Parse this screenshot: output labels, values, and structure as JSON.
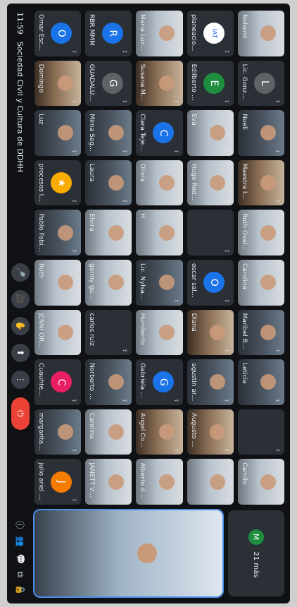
{
  "meeting": {
    "time": "11:59",
    "title": "Sociedad Civil y Cultura de DDHH"
  },
  "tiles": [
    {
      "name": "Nohemi",
      "type": "video",
      "tone": "light"
    },
    {
      "name": "Lic. Gonzalez",
      "type": "avatar",
      "initial": "L",
      "color": "#5f6368"
    },
    {
      "name": "Noeli",
      "type": "video",
      "tone": "dark"
    },
    {
      "name": "Maestra Isabel",
      "type": "video",
      "tone": "warm"
    },
    {
      "name": "Ruth Ovalles",
      "type": "video",
      "tone": "light"
    },
    {
      "name": "Carolina",
      "type": "video",
      "tone": "light"
    },
    {
      "name": "Maribel Berlanga",
      "type": "video",
      "tone": "dark"
    },
    {
      "name": "Leticia",
      "type": "video",
      "tone": "dark"
    },
    {
      "name": "",
      "type": "blank"
    },
    {
      "name": "Camilo",
      "type": "video",
      "tone": "light"
    },
    {
      "name": "planeacion col...",
      "type": "avatar",
      "initial": "IAT",
      "color": "#ffffff"
    },
    {
      "name": "Edilberto Mata...",
      "type": "avatar",
      "initial": "E",
      "color": "#1e8e3e"
    },
    {
      "name": "Eva",
      "type": "video",
      "tone": "light"
    },
    {
      "name": "Hugo Rodriguez",
      "type": "video",
      "tone": "light"
    },
    {
      "name": "",
      "type": "blank"
    },
    {
      "name": "oscar salgado",
      "type": "avatar",
      "initial": "O",
      "color": "#1a73e8"
    },
    {
      "name": "Diana",
      "type": "video",
      "tone": "warm"
    },
    {
      "name": "agustin arcos",
      "type": "video",
      "tone": "dark"
    },
    {
      "name": "Augusto Cervantes",
      "type": "video",
      "tone": "warm"
    },
    {
      "name": "",
      "type": "video",
      "tone": "light"
    },
    {
      "name": "Maria Luz diab",
      "type": "video",
      "tone": "light"
    },
    {
      "name": "Susana Munoz",
      "type": "video",
      "tone": "warm"
    },
    {
      "name": "Clara Tejeda",
      "type": "avatar",
      "initial": "C",
      "color": "#1a73e8"
    },
    {
      "name": "Olivia",
      "type": "video",
      "tone": "light"
    },
    {
      "name": "H",
      "type": "video",
      "tone": "light"
    },
    {
      "name": "Lic. Nylsa Mart...",
      "type": "video",
      "tone": "dark"
    },
    {
      "name": "Humberto",
      "type": "video",
      "tone": "light"
    },
    {
      "name": "Gabriela Cerv...",
      "type": "avatar",
      "initial": "G",
      "color": "#1a73e8"
    },
    {
      "name": "Angel Contreras",
      "type": "video",
      "tone": "warm"
    },
    {
      "name": "Alberto de la R...",
      "type": "video",
      "tone": "light"
    },
    {
      "name": "RBR MMM",
      "type": "avatar",
      "initial": "R",
      "color": "#1a73e8"
    },
    {
      "name": "GUADALUPE R...",
      "type": "avatar",
      "initial": "G",
      "color": "#5f6368"
    },
    {
      "name": "Mirna Segura",
      "type": "video",
      "tone": "dark"
    },
    {
      "name": "Laura",
      "type": "video",
      "tone": "dark"
    },
    {
      "name": "Elvira",
      "type": "video",
      "tone": "light"
    },
    {
      "name": "genny guardad...",
      "type": "video",
      "tone": "light"
    },
    {
      "name": "carlos ruiz",
      "type": "avatar",
      "initial": "",
      "color": "#2b2f36"
    },
    {
      "name": "Norberto Mend...",
      "type": "video",
      "tone": "dark"
    },
    {
      "name": "Carolina",
      "type": "video",
      "tone": "light"
    },
    {
      "name": "JANETT VELAZ...",
      "type": "video",
      "tone": "light"
    },
    {
      "name": "Omar Escalante",
      "type": "avatar",
      "initial": "O",
      "color": "#1a73e8"
    },
    {
      "name": "Domingo",
      "type": "video",
      "tone": "warm"
    },
    {
      "name": "Luz",
      "type": "video",
      "tone": "dark"
    },
    {
      "name": "procesos legisla...",
      "type": "avatar",
      "initial": "★",
      "color": "#f9ab00"
    },
    {
      "name": "Pablo Fabian G...",
      "type": "video",
      "tone": "dark"
    },
    {
      "name": "Ruth",
      "type": "video",
      "tone": "light"
    },
    {
      "name": "JENNI ORDAZ",
      "type": "video",
      "tone": "light"
    },
    {
      "name": "Cuauhtemoc C...",
      "type": "avatar",
      "initial": "C",
      "color": "#e91e63"
    },
    {
      "name": "margarita ant...",
      "type": "video",
      "tone": "dark"
    },
    {
      "name": "julio ariel osun...",
      "type": "avatar",
      "initial": "J",
      "color": "#f57c00"
    }
  ],
  "sidebar": {
    "more_count": "21 más",
    "more_avatar_initial": "M",
    "more_avatar_color": "#1e8e3e"
  },
  "controls": {
    "icons": [
      "mic-icon",
      "camera-icon",
      "hand-icon",
      "present-icon",
      "more-icon",
      "end-call-icon"
    ],
    "right_icons": [
      "info-icon",
      "people-icon",
      "chat-icon",
      "activities-icon",
      "lock-icon"
    ]
  }
}
